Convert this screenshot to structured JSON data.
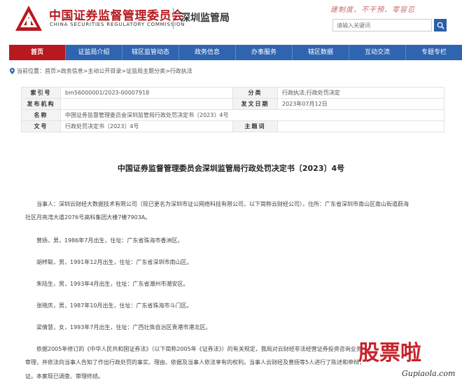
{
  "header": {
    "cn_title": "中国证券监督管理委员会",
    "en_title": "CHINA SECURITIES REGULATORY COMMISSION",
    "bureau": "深圳监管局",
    "slogan": "建制度、不干预、零容忍",
    "search_placeholder": "请输入关键词",
    "brand_color": "#b8191f"
  },
  "nav": {
    "items": [
      "首页",
      "证监局介绍",
      "辖区监管动态",
      "政务信息",
      "办事服务",
      "辖区数据",
      "互动交流",
      "专题专栏"
    ],
    "active_index": 0,
    "bg_color": "#2f64b0"
  },
  "breadcrumb": {
    "prefix": "当前位置：",
    "items": [
      "首页",
      "政务信息",
      "主动公开目录",
      "证监局主题分类",
      "行政执法"
    ],
    "sep": " > "
  },
  "meta": {
    "rows": [
      {
        "l1": "索引号",
        "v1": "bm56000001/2023-00007918",
        "l2": "分类",
        "v2": "行政执法;行政处罚决定"
      },
      {
        "l1": "发布机构",
        "v1": "",
        "l2": "发文日期",
        "v2": "2023年07月12日"
      },
      {
        "l1": "名称",
        "v1": "中国证券监督管理委员会深圳监管局行政处罚决定书〔2023〕4号",
        "l2": "",
        "v2": ""
      },
      {
        "l1": "文号",
        "v1": "行政处罚决定书〔2023〕4号",
        "l2": "主题词",
        "v2": ""
      }
    ]
  },
  "document": {
    "title": "中国证券监督管理委员会深圳监管局行政处罚决定书〔2023〕4号",
    "paragraphs": [
      "当事人：深圳云财经大数据技术有限公司（现已更名为深圳市证公网络科技有限公司，以下简称云财经公司），住所：广东省深圳市南山区南山街道蔚海",
      "社区月亮湾大道2076号高科集团大楼7楼7903A。",
      "曾扬，男，1986年7月出生，住址：广东省珠海市香洲区。",
      "胡梓聪，男，1991年12月出生，住址：广东省深圳市南山区。",
      "朱陆生，男，1993年4月出生，住址：广东省潮州市潮安区。",
      "张晓庆，男，1987年10月出生，住址：广东省珠海市斗门区。",
      "梁倩慧，女，1993年7月出生，住址：广西壮族自治区贵港市港北区。",
      "依据2005年修订的《中华人民共和国证券法》（以下简称2005年《证券法》）的有关规定，我局对云财经非法经营证券投资咨询业务",
      "审理，并依法向当事人告知了作出行政处罚的事实、理由、依据及当事人依法享有的权利。当事人云财经及曾扬等5人进行了陈述和申辩，",
      "证。本案现已调查、审理终结。"
    ]
  },
  "watermark": {
    "chars": [
      "股",
      "票",
      "啦"
    ],
    "url": "Gupiaola.com",
    "color": "#c7232a"
  }
}
